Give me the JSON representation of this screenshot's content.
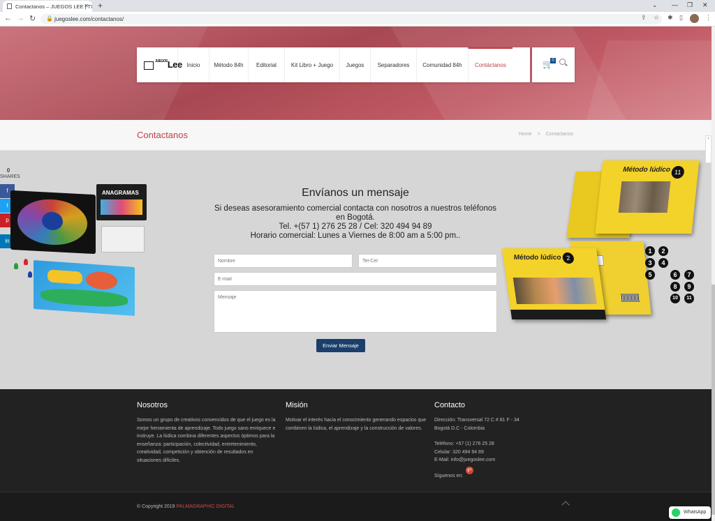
{
  "browser": {
    "tab_title": "Contactanos – JUEGOS LEE | TIE",
    "url": "juegoslee.com/contactanos/"
  },
  "nav": {
    "logo": "Lee",
    "logo_small": "JUEGOS",
    "items": [
      "Inicio",
      "Método 84h",
      "Editorial",
      "Kit Libro + Juego",
      "Juegos",
      "Separadores",
      "Comunidad 84h",
      "Contáctanos"
    ],
    "cart_count": "0"
  },
  "titlebar": {
    "title": "Contactanos",
    "breadcrumb_home": "Home",
    "breadcrumb_sep": ">",
    "breadcrumb_current": "Contactanos"
  },
  "share": {
    "count": "0",
    "label": "SHARES",
    "colors": [
      "#3b5998",
      "#1da1f2",
      "#cb2027",
      "#0077b5"
    ],
    "icons": [
      "facebook-icon",
      "twitter-icon",
      "pinterest-icon",
      "linkedin-icon"
    ],
    "glyphs": [
      "f",
      "t",
      "p",
      "in"
    ]
  },
  "form": {
    "heading": "Envíanos un mensaje",
    "desc1": "Si deseas asesoramiento comercial contacta con nosotros a nuestros teléfonos en Bogotá.",
    "desc2": "Tel. +(57 1) 276 25 28 / Cel: 320 494 94 89",
    "desc3": "Horario comercial: Lunes a Viernes de 8:00 am a 5:00 pm..",
    "name_placeholder": "Nombre",
    "phone_placeholder": "Tel-Cel",
    "email_placeholder": "E-mail",
    "message_placeholder": "Mensaje",
    "submit_label": "Enviar Mensaje"
  },
  "promo": {
    "game1": "ANAGRAMAS",
    "book_title": "Método lúdico",
    "book_num_a": "11",
    "book_num_b": "2",
    "numbers": [
      "1",
      "2",
      "3",
      "4",
      "5",
      "6",
      "7",
      "8",
      "9",
      "10",
      "11"
    ]
  },
  "footer": {
    "about_title": "Nosotros",
    "about_text": "Somos un grupo de creativos convencidos de que el juego es la mejor herramienta de aprendizaje. Todo juego sano enriquece e instruye. La lúdica combina diferentes aspectos óptimos para la enseñanza: participación, colectividad, entretenimiento, creatividad, competición y obtención de resultados en situaciones difíciles.",
    "mission_title": "Misión",
    "mission_text": "Motivar el interés hacia el conocimiento generando espacios que combinen la lúdica, el aprendizaje y la construcción de valores.",
    "contact_title": "Contacto",
    "address": "Dirección: Transversal 72 C # 81 F - 34",
    "city": "Bogotá D.C - Colombia",
    "phone": "Teléfono: +57 (1) 276 25 28",
    "mobile": "Celular: 320 494 94 89",
    "email": "E-Mail: info@juegoslee.com",
    "follow": "Síguenos en:",
    "gplus": "g+"
  },
  "bottom": {
    "copyright": "© Copyright 2019",
    "brand": "PALMAGRAPHIC DIGITAL"
  },
  "whatsapp": {
    "label": "WhatsApp"
  }
}
